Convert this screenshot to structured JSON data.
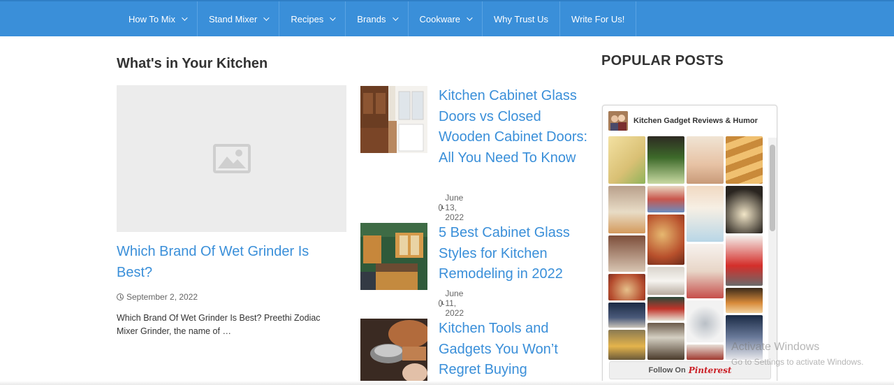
{
  "nav": {
    "items": [
      {
        "label": "How To Mix",
        "dropdown": true
      },
      {
        "label": "Stand Mixer",
        "dropdown": true
      },
      {
        "label": "Recipes",
        "dropdown": true
      },
      {
        "label": "Brands",
        "dropdown": true
      },
      {
        "label": "Cookware",
        "dropdown": true
      },
      {
        "label": "Why Trust Us",
        "dropdown": false
      },
      {
        "label": "Write For Us!",
        "dropdown": false
      }
    ]
  },
  "main": {
    "section_title": "What's in Your Kitchen",
    "featured": {
      "title": "Which Brand Of Wet Grinder Is Best?",
      "date": "September 2, 2022",
      "excerpt": "Which Brand Of Wet Grinder Is Best? Preethi Zodiac Mixer Grinder, the name of …"
    },
    "posts": [
      {
        "title": "Kitchen Cabinet Glass Doors vs Closed Wooden Cabinet Doors: All You Need To Know",
        "date": "June 13, 2022"
      },
      {
        "title": "5 Best Cabinet Glass Styles for Kitchen Remodeling in 2022",
        "date": "June 11, 2022"
      },
      {
        "title": "Kitchen Tools and Gadgets You Won’t Regret Buying",
        "date": ""
      }
    ]
  },
  "sidebar": {
    "title": "POPULAR POSTS",
    "widget": {
      "name": "Kitchen Gadget Reviews & Humor",
      "follow_label": "Follow On",
      "brand": "Pinterest"
    }
  },
  "watermark": {
    "title": "Activate Windows",
    "subtitle": "Go to Settings to activate Windows."
  },
  "colors": {
    "nav_bg": "#3a8fd9",
    "link": "#3a8fd9",
    "pinterest_red": "#cb2027"
  },
  "icons": [
    "chevron-down-icon",
    "image-placeholder-icon",
    "clock-icon"
  ]
}
